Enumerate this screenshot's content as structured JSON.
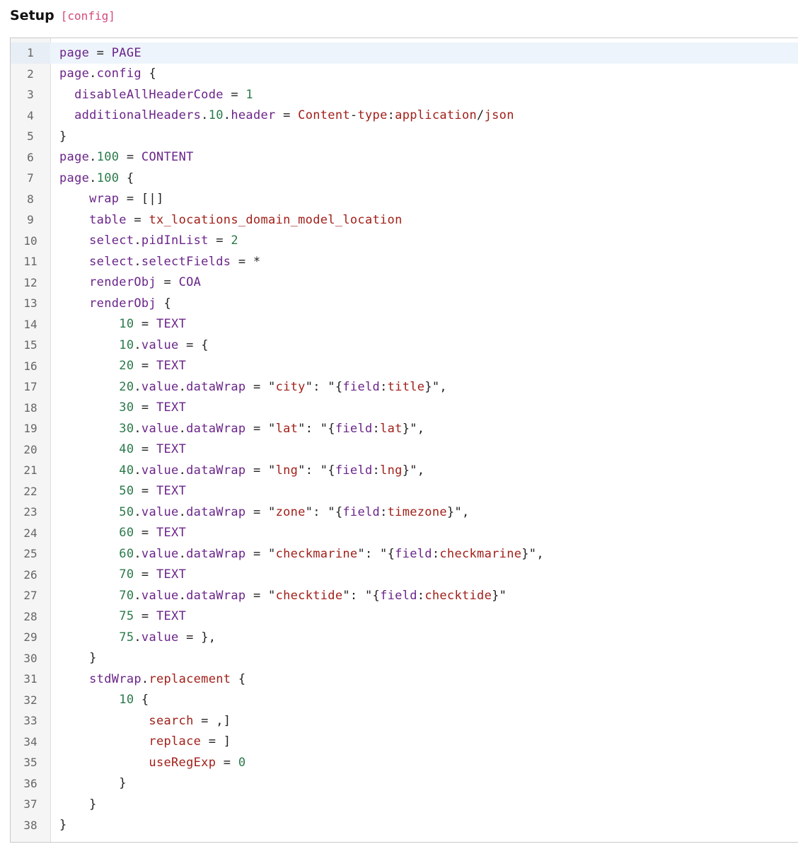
{
  "header": {
    "title": "Setup",
    "tag": "[config]"
  },
  "editor": {
    "active_line": 1,
    "lines": [
      {
        "n": "1",
        "tokens": [
          [
            "prop",
            "page"
          ],
          [
            "op",
            " = "
          ],
          [
            "kw",
            "PAGE"
          ]
        ]
      },
      {
        "n": "2",
        "tokens": [
          [
            "prop",
            "page"
          ],
          [
            "op",
            "."
          ],
          [
            "prop",
            "config"
          ],
          [
            "op",
            " {"
          ]
        ]
      },
      {
        "n": "3",
        "tokens": [
          [
            "op",
            "  "
          ],
          [
            "prop",
            "disableAllHeaderCode"
          ],
          [
            "op",
            " = "
          ],
          [
            "num",
            "1"
          ]
        ]
      },
      {
        "n": "4",
        "tokens": [
          [
            "op",
            "  "
          ],
          [
            "prop",
            "additionalHeaders"
          ],
          [
            "op",
            "."
          ],
          [
            "num",
            "10"
          ],
          [
            "op",
            "."
          ],
          [
            "prop",
            "header"
          ],
          [
            "op",
            " = "
          ],
          [
            "val",
            "Content"
          ],
          [
            "op",
            "-"
          ],
          [
            "val",
            "type"
          ],
          [
            "op",
            ":"
          ],
          [
            "val",
            "application"
          ],
          [
            "op",
            "/"
          ],
          [
            "val",
            "json"
          ]
        ]
      },
      {
        "n": "5",
        "tokens": [
          [
            "op",
            "}"
          ]
        ]
      },
      {
        "n": "6",
        "tokens": [
          [
            "prop",
            "page"
          ],
          [
            "op",
            "."
          ],
          [
            "num",
            "100"
          ],
          [
            "op",
            " = "
          ],
          [
            "kw",
            "CONTENT"
          ]
        ]
      },
      {
        "n": "7",
        "tokens": [
          [
            "prop",
            "page"
          ],
          [
            "op",
            "."
          ],
          [
            "num",
            "100"
          ],
          [
            "op",
            " {"
          ]
        ]
      },
      {
        "n": "8",
        "tokens": [
          [
            "op",
            "    "
          ],
          [
            "prop",
            "wrap"
          ],
          [
            "op",
            " = [|]"
          ]
        ]
      },
      {
        "n": "9",
        "tokens": [
          [
            "op",
            "    "
          ],
          [
            "prop",
            "table"
          ],
          [
            "op",
            " = "
          ],
          [
            "val",
            "tx_locations_domain_model_location"
          ]
        ]
      },
      {
        "n": "10",
        "tokens": [
          [
            "op",
            "    "
          ],
          [
            "prop",
            "select"
          ],
          [
            "op",
            "."
          ],
          [
            "prop",
            "pidInList"
          ],
          [
            "op",
            " = "
          ],
          [
            "num",
            "2"
          ]
        ]
      },
      {
        "n": "11",
        "tokens": [
          [
            "op",
            "    "
          ],
          [
            "prop",
            "select"
          ],
          [
            "op",
            "."
          ],
          [
            "prop",
            "selectFields"
          ],
          [
            "op",
            " = *"
          ]
        ]
      },
      {
        "n": "12",
        "tokens": [
          [
            "op",
            "    "
          ],
          [
            "prop",
            "renderObj"
          ],
          [
            "op",
            " = "
          ],
          [
            "kw",
            "COA"
          ]
        ]
      },
      {
        "n": "13",
        "tokens": [
          [
            "op",
            "    "
          ],
          [
            "prop",
            "renderObj"
          ],
          [
            "op",
            " {"
          ]
        ]
      },
      {
        "n": "14",
        "tokens": [
          [
            "op",
            "        "
          ],
          [
            "num",
            "10"
          ],
          [
            "op",
            " = "
          ],
          [
            "kw",
            "TEXT"
          ]
        ]
      },
      {
        "n": "15",
        "tokens": [
          [
            "op",
            "        "
          ],
          [
            "num",
            "10"
          ],
          [
            "op",
            "."
          ],
          [
            "prop",
            "value"
          ],
          [
            "op",
            " = {"
          ]
        ]
      },
      {
        "n": "16",
        "tokens": [
          [
            "op",
            "        "
          ],
          [
            "num",
            "20"
          ],
          [
            "op",
            " = "
          ],
          [
            "kw",
            "TEXT"
          ]
        ]
      },
      {
        "n": "17",
        "tokens": [
          [
            "op",
            "        "
          ],
          [
            "num",
            "20"
          ],
          [
            "op",
            "."
          ],
          [
            "prop",
            "value"
          ],
          [
            "op",
            "."
          ],
          [
            "prop",
            "dataWrap"
          ],
          [
            "op",
            " = \""
          ],
          [
            "val",
            "city"
          ],
          [
            "op",
            "\": \"{"
          ],
          [
            "prop",
            "field"
          ],
          [
            "op",
            ":"
          ],
          [
            "val",
            "title"
          ],
          [
            "op",
            "}\","
          ]
        ]
      },
      {
        "n": "18",
        "tokens": [
          [
            "op",
            "        "
          ],
          [
            "num",
            "30"
          ],
          [
            "op",
            " = "
          ],
          [
            "kw",
            "TEXT"
          ]
        ]
      },
      {
        "n": "19",
        "tokens": [
          [
            "op",
            "        "
          ],
          [
            "num",
            "30"
          ],
          [
            "op",
            "."
          ],
          [
            "prop",
            "value"
          ],
          [
            "op",
            "."
          ],
          [
            "prop",
            "dataWrap"
          ],
          [
            "op",
            " = \""
          ],
          [
            "val",
            "lat"
          ],
          [
            "op",
            "\": \"{"
          ],
          [
            "prop",
            "field"
          ],
          [
            "op",
            ":"
          ],
          [
            "val",
            "lat"
          ],
          [
            "op",
            "}\","
          ]
        ]
      },
      {
        "n": "20",
        "tokens": [
          [
            "op",
            "        "
          ],
          [
            "num",
            "40"
          ],
          [
            "op",
            " = "
          ],
          [
            "kw",
            "TEXT"
          ]
        ]
      },
      {
        "n": "21",
        "tokens": [
          [
            "op",
            "        "
          ],
          [
            "num",
            "40"
          ],
          [
            "op",
            "."
          ],
          [
            "prop",
            "value"
          ],
          [
            "op",
            "."
          ],
          [
            "prop",
            "dataWrap"
          ],
          [
            "op",
            " = \""
          ],
          [
            "val",
            "lng"
          ],
          [
            "op",
            "\": \"{"
          ],
          [
            "prop",
            "field"
          ],
          [
            "op",
            ":"
          ],
          [
            "val",
            "lng"
          ],
          [
            "op",
            "}\","
          ]
        ]
      },
      {
        "n": "22",
        "tokens": [
          [
            "op",
            "        "
          ],
          [
            "num",
            "50"
          ],
          [
            "op",
            " = "
          ],
          [
            "kw",
            "TEXT"
          ]
        ]
      },
      {
        "n": "23",
        "tokens": [
          [
            "op",
            "        "
          ],
          [
            "num",
            "50"
          ],
          [
            "op",
            "."
          ],
          [
            "prop",
            "value"
          ],
          [
            "op",
            "."
          ],
          [
            "prop",
            "dataWrap"
          ],
          [
            "op",
            " = \""
          ],
          [
            "val",
            "zone"
          ],
          [
            "op",
            "\": \"{"
          ],
          [
            "prop",
            "field"
          ],
          [
            "op",
            ":"
          ],
          [
            "val",
            "timezone"
          ],
          [
            "op",
            "}\","
          ]
        ]
      },
      {
        "n": "24",
        "tokens": [
          [
            "op",
            "        "
          ],
          [
            "num",
            "60"
          ],
          [
            "op",
            " = "
          ],
          [
            "kw",
            "TEXT"
          ]
        ]
      },
      {
        "n": "25",
        "tokens": [
          [
            "op",
            "        "
          ],
          [
            "num",
            "60"
          ],
          [
            "op",
            "."
          ],
          [
            "prop",
            "value"
          ],
          [
            "op",
            "."
          ],
          [
            "prop",
            "dataWrap"
          ],
          [
            "op",
            " = \""
          ],
          [
            "val",
            "checkmarine"
          ],
          [
            "op",
            "\": \"{"
          ],
          [
            "prop",
            "field"
          ],
          [
            "op",
            ":"
          ],
          [
            "val",
            "checkmarine"
          ],
          [
            "op",
            "}\","
          ]
        ]
      },
      {
        "n": "26",
        "tokens": [
          [
            "op",
            "        "
          ],
          [
            "num",
            "70"
          ],
          [
            "op",
            " = "
          ],
          [
            "kw",
            "TEXT"
          ]
        ]
      },
      {
        "n": "27",
        "tokens": [
          [
            "op",
            "        "
          ],
          [
            "num",
            "70"
          ],
          [
            "op",
            "."
          ],
          [
            "prop",
            "value"
          ],
          [
            "op",
            "."
          ],
          [
            "prop",
            "dataWrap"
          ],
          [
            "op",
            " = \""
          ],
          [
            "val",
            "checktide"
          ],
          [
            "op",
            "\": \"{"
          ],
          [
            "prop",
            "field"
          ],
          [
            "op",
            ":"
          ],
          [
            "val",
            "checktide"
          ],
          [
            "op",
            "}\""
          ]
        ]
      },
      {
        "n": "28",
        "tokens": [
          [
            "op",
            "        "
          ],
          [
            "num",
            "75"
          ],
          [
            "op",
            " = "
          ],
          [
            "kw",
            "TEXT"
          ]
        ]
      },
      {
        "n": "29",
        "tokens": [
          [
            "op",
            "        "
          ],
          [
            "num",
            "75"
          ],
          [
            "op",
            "."
          ],
          [
            "prop",
            "value"
          ],
          [
            "op",
            " = },"
          ]
        ]
      },
      {
        "n": "30",
        "tokens": [
          [
            "op",
            "    }"
          ]
        ]
      },
      {
        "n": "31",
        "tokens": [
          [
            "op",
            "    "
          ],
          [
            "prop",
            "stdWrap"
          ],
          [
            "op",
            "."
          ],
          [
            "val",
            "replacement"
          ],
          [
            "op",
            " {"
          ]
        ]
      },
      {
        "n": "32",
        "tokens": [
          [
            "op",
            "        "
          ],
          [
            "num",
            "10"
          ],
          [
            "op",
            " {"
          ]
        ]
      },
      {
        "n": "33",
        "tokens": [
          [
            "op",
            "            "
          ],
          [
            "val",
            "search"
          ],
          [
            "op",
            " = ,]"
          ]
        ]
      },
      {
        "n": "34",
        "tokens": [
          [
            "op",
            "            "
          ],
          [
            "val",
            "replace"
          ],
          [
            "op",
            " = ]"
          ]
        ]
      },
      {
        "n": "35",
        "tokens": [
          [
            "op",
            "            "
          ],
          [
            "val",
            "useRegExp"
          ],
          [
            "op",
            " = "
          ],
          [
            "num",
            "0"
          ]
        ]
      },
      {
        "n": "36",
        "tokens": [
          [
            "op",
            "        }"
          ]
        ]
      },
      {
        "n": "37",
        "tokens": [
          [
            "op",
            "    }"
          ]
        ]
      },
      {
        "n": "38",
        "tokens": [
          [
            "op",
            "}"
          ]
        ]
      }
    ]
  }
}
